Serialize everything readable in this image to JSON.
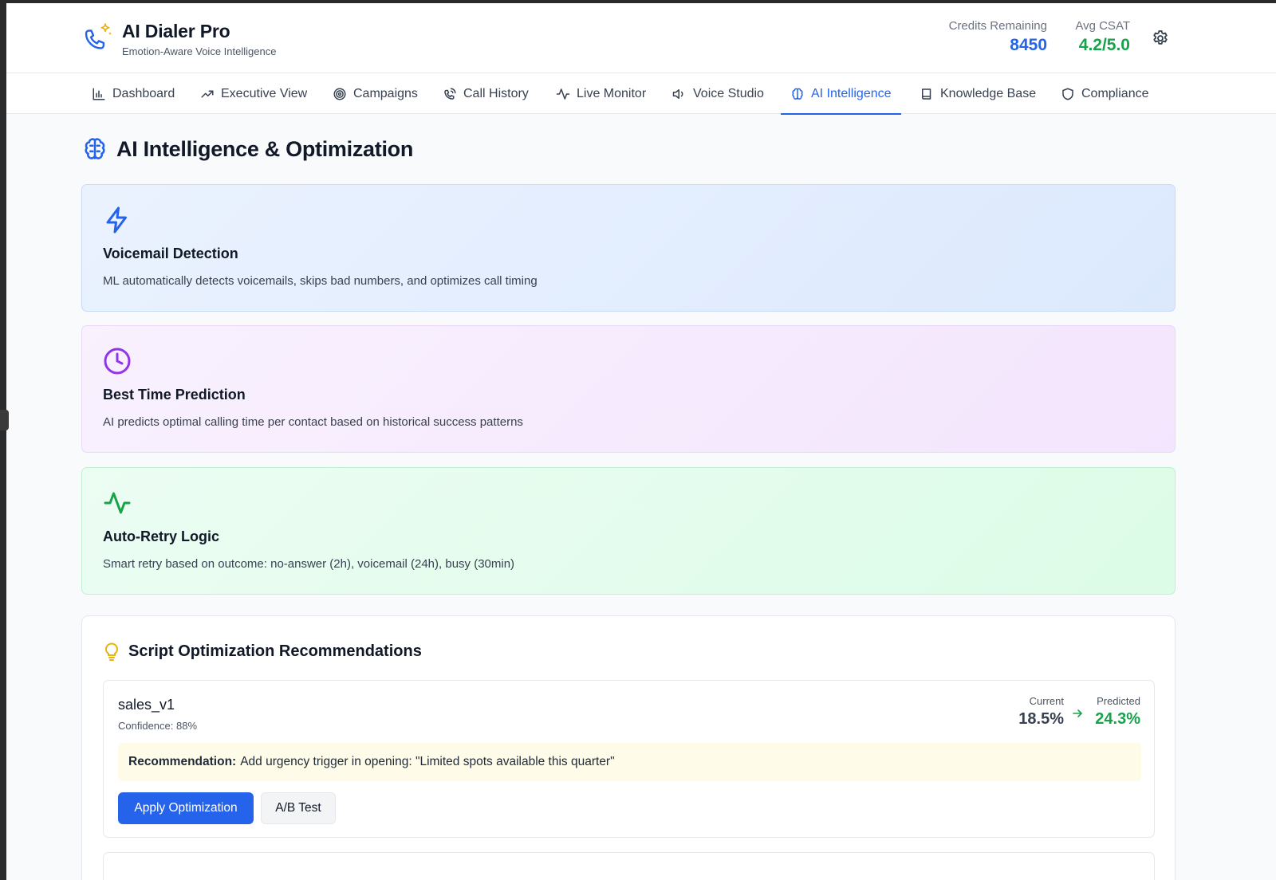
{
  "app": {
    "title": "AI Dialer Pro",
    "subtitle": "Emotion-Aware Voice Intelligence",
    "icon": "phone-sparkle-icon"
  },
  "stats": {
    "credits_label": "Credits Remaining",
    "credits_value": "8450",
    "csat_label": "Avg CSAT",
    "csat_value": "4.2/5.0"
  },
  "nav": [
    {
      "label": "Dashboard",
      "icon": "bar-chart-icon"
    },
    {
      "label": "Executive View",
      "icon": "trending-up-icon"
    },
    {
      "label": "Campaigns",
      "icon": "target-icon"
    },
    {
      "label": "Call History",
      "icon": "phone-call-icon"
    },
    {
      "label": "Live Monitor",
      "icon": "activity-icon"
    },
    {
      "label": "Voice Studio",
      "icon": "speaker-icon"
    },
    {
      "label": "AI Intelligence",
      "icon": "brain-icon",
      "active": true
    },
    {
      "label": "Knowledge Base",
      "icon": "book-icon"
    },
    {
      "label": "Compliance",
      "icon": "shield-icon"
    }
  ],
  "page": {
    "title": "AI Intelligence & Optimization"
  },
  "features": [
    {
      "title": "Voicemail Detection",
      "description": "ML automatically detects voicemails, skips bad numbers, and optimizes call timing",
      "icon": "lightning-icon",
      "color": "#2563eb"
    },
    {
      "title": "Best Time Prediction",
      "description": "AI predicts optimal calling time per contact based on historical success patterns",
      "icon": "clock-icon",
      "color": "#9333ea"
    },
    {
      "title": "Auto-Retry Logic",
      "description": "Smart retry based on outcome: no-answer (2h), voicemail (24h), busy (30min)",
      "icon": "activity-icon",
      "color": "#16a34a"
    }
  ],
  "recommendations": {
    "title": "Script Optimization Recommendations",
    "icon": "lightbulb-icon",
    "items": [
      {
        "script": "sales_v1",
        "confidence": "Confidence: 88%",
        "current_label": "Current",
        "current_value": "18.5%",
        "predicted_label": "Predicted",
        "predicted_value": "24.3%",
        "recommendation_label": "Recommendation:",
        "recommendation_text": "Add urgency trigger in opening: \"Limited spots available this quarter\"",
        "apply_label": "Apply Optimization",
        "ab_label": "A/B Test"
      }
    ]
  },
  "colors": {
    "accent": "#2563eb",
    "success": "#16a34a"
  }
}
